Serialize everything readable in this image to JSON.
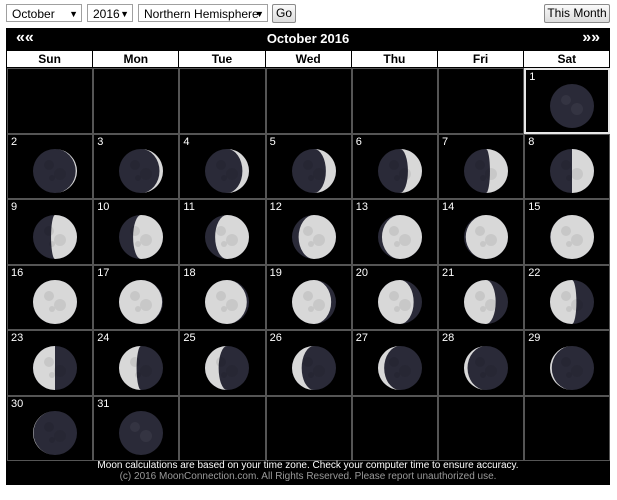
{
  "toolbar": {
    "month": "October",
    "year": "2016",
    "hemisphere": "Northern Hemisphere",
    "go_label": "Go",
    "this_month_label": "This Month"
  },
  "calendar": {
    "title": "October 2016",
    "prev_label": "««",
    "next_label": "»»",
    "weekdays": [
      "Sun",
      "Mon",
      "Tue",
      "Wed",
      "Thu",
      "Fri",
      "Sat"
    ],
    "first_weekday_index": 6,
    "days": [
      {
        "day": "1",
        "illumination": 0.0,
        "phase": "waxing"
      },
      {
        "day": "2",
        "illumination": 0.03,
        "phase": "waxing"
      },
      {
        "day": "3",
        "illumination": 0.08,
        "phase": "waxing"
      },
      {
        "day": "4",
        "illumination": 0.15,
        "phase": "waxing"
      },
      {
        "day": "5",
        "illumination": 0.23,
        "phase": "waxing"
      },
      {
        "day": "6",
        "illumination": 0.32,
        "phase": "waxing"
      },
      {
        "day": "7",
        "illumination": 0.41,
        "phase": "waxing"
      },
      {
        "day": "8",
        "illumination": 0.5,
        "phase": "waxing"
      },
      {
        "day": "9",
        "illumination": 0.59,
        "phase": "waxing"
      },
      {
        "day": "10",
        "illumination": 0.68,
        "phase": "waxing"
      },
      {
        "day": "11",
        "illumination": 0.77,
        "phase": "waxing"
      },
      {
        "day": "12",
        "illumination": 0.85,
        "phase": "waxing"
      },
      {
        "day": "13",
        "illumination": 0.91,
        "phase": "waxing"
      },
      {
        "day": "14",
        "illumination": 0.96,
        "phase": "waxing"
      },
      {
        "day": "15",
        "illumination": 0.99,
        "phase": "waxing"
      },
      {
        "day": "16",
        "illumination": 1.0,
        "phase": "full"
      },
      {
        "day": "17",
        "illumination": 0.98,
        "phase": "waning"
      },
      {
        "day": "18",
        "illumination": 0.95,
        "phase": "waning"
      },
      {
        "day": "19",
        "illumination": 0.89,
        "phase": "waning"
      },
      {
        "day": "20",
        "illumination": 0.81,
        "phase": "waning"
      },
      {
        "day": "21",
        "illumination": 0.72,
        "phase": "waning"
      },
      {
        "day": "22",
        "illumination": 0.6,
        "phase": "waning"
      },
      {
        "day": "23",
        "illumination": 0.5,
        "phase": "waning"
      },
      {
        "day": "24",
        "illumination": 0.4,
        "phase": "waning"
      },
      {
        "day": "25",
        "illumination": 0.31,
        "phase": "waning"
      },
      {
        "day": "26",
        "illumination": 0.22,
        "phase": "waning"
      },
      {
        "day": "27",
        "illumination": 0.14,
        "phase": "waning"
      },
      {
        "day": "28",
        "illumination": 0.08,
        "phase": "waning"
      },
      {
        "day": "29",
        "illumination": 0.04,
        "phase": "waning"
      },
      {
        "day": "30",
        "illumination": 0.01,
        "phase": "waning"
      },
      {
        "day": "31",
        "illumination": 0.0,
        "phase": "new"
      }
    ],
    "today": "1",
    "colors": {
      "background": "#000000",
      "moon_lit": "#d8d8d8",
      "moon_dark": "#2a2a38",
      "text": "#ffffff"
    }
  },
  "footer": {
    "notice": "Moon calculations are based on your time zone. Check your computer time to ensure accuracy.",
    "copyright": "(c) 2016 MoonConnection.com. All Rights Reserved. Please report unauthorized use."
  }
}
